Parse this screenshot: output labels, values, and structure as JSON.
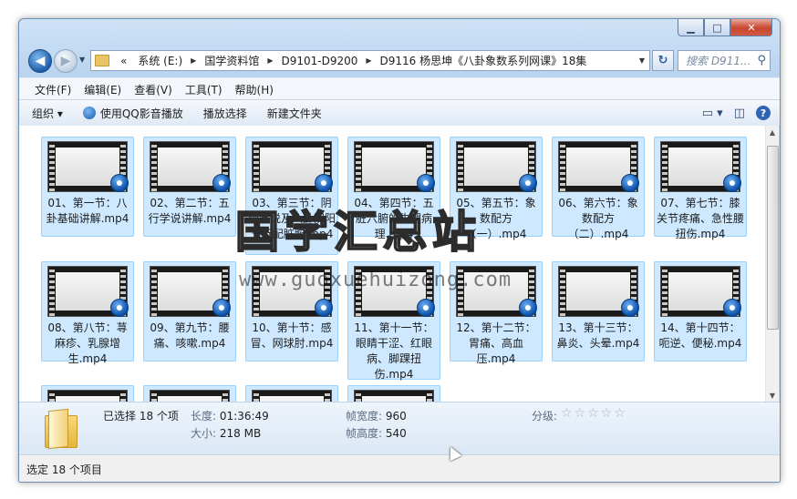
{
  "nav": {
    "address": [
      "«",
      "系统 (E:)",
      "国学资料馆",
      "D9101-D9200",
      "D9116 杨思坤《八卦象数系列网课》18集"
    ],
    "search_placeholder": "搜索 D911..."
  },
  "menu": [
    "文件(F)",
    "编辑(E)",
    "查看(V)",
    "工具(T)",
    "帮助(H)"
  ],
  "toolbar": {
    "organize": "组织 ▾",
    "qq_play": "使用QQ影音播放",
    "play_selection": "播放选择",
    "new_folder": "新建文件夹"
  },
  "files": [
    "01、第一节：八卦基础讲解.mp4",
    "02、第二节：五行学说讲解.mp4",
    "03、第三节：阴阳学说及八卦阴阳五行配脏腑.mp4",
    "04、第四节：五脏六腑的生理病理.mp4",
    "05、第五节：象数配方（一）.mp4",
    "06、第六节：象数配方（二）.mp4",
    "07、第七节：膝关节疼痛、急性腰扭伤.mp4",
    "08、第八节：荨麻疹、乳腺增生.mp4",
    "09、第九节：腰痛、咳嗽.mp4",
    "10、第十节：感冒、网球肘.mp4",
    "11、第十一节：眼睛干涩、红眼病、脚踝扭伤.mp4",
    "12、第十二节：胃痛、高血压.mp4",
    "13、第十三节：鼻炎、头晕.mp4",
    "14、第十四节：呃逆、便秘.mp4"
  ],
  "details": {
    "selected": "已选择 18 个项",
    "length_label": "长度:",
    "length_value": "01:36:49",
    "size_label": "大小:",
    "size_value": "218 MB",
    "frame_width_label": "帧宽度:",
    "frame_width_value": "960",
    "frame_height_label": "帧高度:",
    "frame_height_value": "540",
    "rating_label": "分级:",
    "rating_stars": "☆☆☆☆☆"
  },
  "status": "选定 18 个项目",
  "watermark": {
    "title": "国学汇总站",
    "url": "www.guoxuehuizong.com"
  }
}
